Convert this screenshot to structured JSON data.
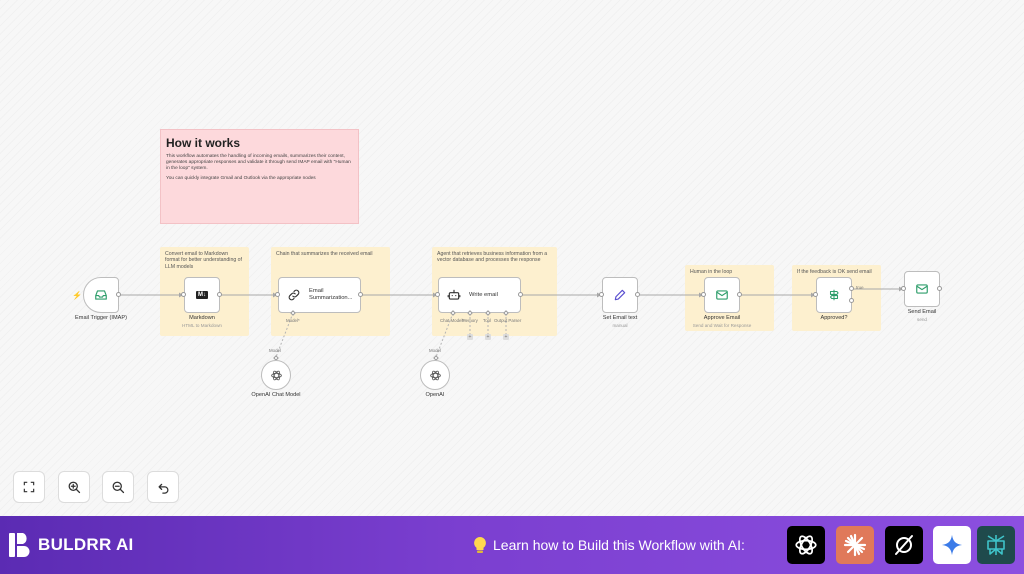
{
  "canvas": {
    "how_it_works": {
      "title": "How it works",
      "para1": "This workflow automates the handling of incoming emails, summarizes their content, generates appropriate responses and validate it through send IMAP email with \"Human in the loop\" system.",
      "para2": "You can quickly integrate Gmail and Outlook via the appropriate nodes"
    },
    "stickies": [
      {
        "text": "Convert email to Markdown format for better understanding of LLM models"
      },
      {
        "text": "Chain that summarizes the received email"
      },
      {
        "text": "Agent that retrieves business information from a vector database and processes the response"
      },
      {
        "text": "Human in the loop"
      },
      {
        "text": "If the feedback is OK send email"
      }
    ],
    "nodes": {
      "email_trigger": {
        "title": "Email Trigger (IMAP)"
      },
      "markdown": {
        "title": "Markdown",
        "subtitle": "HTML to Markdown",
        "badge": "M↓"
      },
      "summarization": {
        "title": "Email Summarization...",
        "port_label": "Model*"
      },
      "write_email": {
        "title": "Write email",
        "port_labels": [
          "Chat Model*",
          "Memory",
          "Tool",
          "Output Parser"
        ]
      },
      "set_email_text": {
        "title": "Set Email text",
        "subtitle": "manual"
      },
      "approve_email": {
        "title": "Approve Email",
        "subtitle": "Send and Wait for Response"
      },
      "approved": {
        "title": "Approved?",
        "branch_label": "true"
      },
      "send_email": {
        "title": "Send Email",
        "subtitle": "send"
      },
      "openai_chat_model": {
        "title": "OpenAI Chat Model",
        "port_label": "Model"
      },
      "openai": {
        "title": "OpenAI",
        "port_label": "Model"
      }
    }
  },
  "controls": {
    "fit": "fit-view",
    "zoom_in": "zoom-in",
    "zoom_out": "zoom-out",
    "undo": "undo"
  },
  "footer": {
    "brand": "BULDRR AI",
    "learn_text": "Learn how to Build this Workflow with AI:",
    "ai_tools": [
      {
        "icon": "chatgpt-icon",
        "color": "#000000"
      },
      {
        "icon": "claude-icon",
        "color": "#e0795a"
      },
      {
        "icon": "grok-icon",
        "color": "#000000"
      },
      {
        "icon": "gemini-icon",
        "color": "#ffffff"
      },
      {
        "icon": "perplexity-icon",
        "color": "#1f4a4c"
      }
    ]
  },
  "colors": {
    "canvas_bg": "#f7f7f7",
    "sticky_yellow": "#fdf0cf",
    "sticky_pink": "#fdd9dc",
    "accent_green": "#2e9e6b",
    "accent_purple": "#7b3fd0",
    "trigger_red": "#ff6d5a"
  }
}
